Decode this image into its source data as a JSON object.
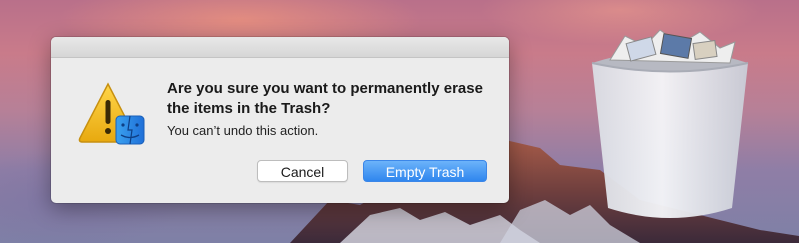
{
  "dialog": {
    "title": "Are you sure you want to permanently erase the items in the Trash?",
    "message": "You can’t undo this action.",
    "cancel_label": "Cancel",
    "confirm_label": "Empty Trash",
    "icon": "warning-finder-icon"
  },
  "desktop": {
    "icon": "full-trash-icon"
  },
  "colors": {
    "primary_button": "#3d8ff2",
    "warning_triangle": "#f2c12e",
    "dialog_background": "#ececec"
  }
}
